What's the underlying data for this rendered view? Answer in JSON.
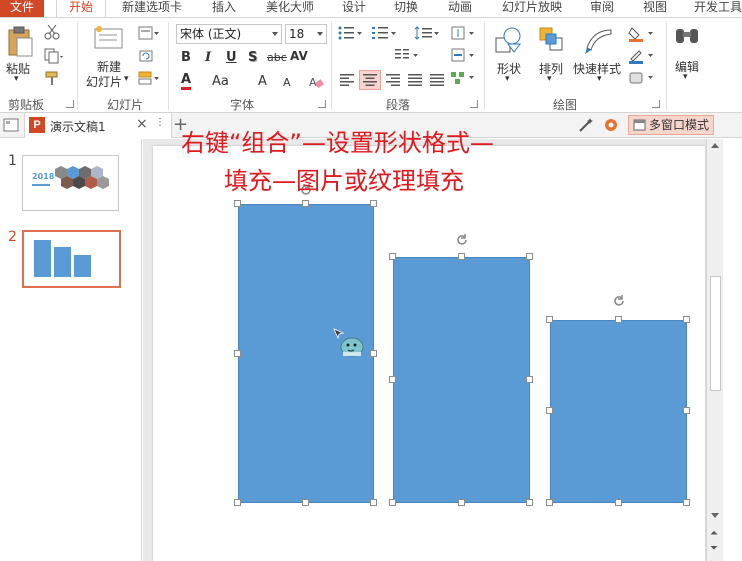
{
  "menu": {
    "tabs": [
      "文件",
      "开始",
      "新建选项卡",
      "插入",
      "美化大师",
      "设计",
      "切换",
      "动画",
      "幻灯片放映",
      "审阅",
      "视图",
      "开发工具"
    ],
    "active_tab": "开始"
  },
  "ribbon": {
    "clipboard": {
      "paste": "粘贴",
      "label": "剪贴板"
    },
    "slides": {
      "new_slide_line1": "新建",
      "new_slide_line2": "幻灯片",
      "label": "幻灯片"
    },
    "font": {
      "font_name": "宋体 (正文)",
      "font_size": "18",
      "label": "字体",
      "bold": "B",
      "italic": "I",
      "underline": "U",
      "shadow": "S",
      "strike": "abc",
      "spacing": "AV",
      "font_color": "A",
      "change_case": "Aa",
      "grow": "A",
      "shrink": "A"
    },
    "paragraph": {
      "label": "段落"
    },
    "drawing": {
      "shapes": "形状",
      "arrange": "排列",
      "quick_styles": "快速样式",
      "label": "绘图"
    },
    "editing": {
      "edit": "编辑"
    }
  },
  "docbar": {
    "doc_title": "演示文稿1",
    "ppt_badge": "P",
    "mode_button": "多窗口模式"
  },
  "thumbnails": [
    {
      "number": "1",
      "caption": "2018"
    },
    {
      "number": "2"
    }
  ],
  "annotation": {
    "line1": "右键“组合”—设置形状格式—",
    "line2": "填充—图片或纹理填充"
  },
  "colors": {
    "accent": "#d24726",
    "bar_fill": "#5b9bd5",
    "annotation": "#e0191e"
  }
}
